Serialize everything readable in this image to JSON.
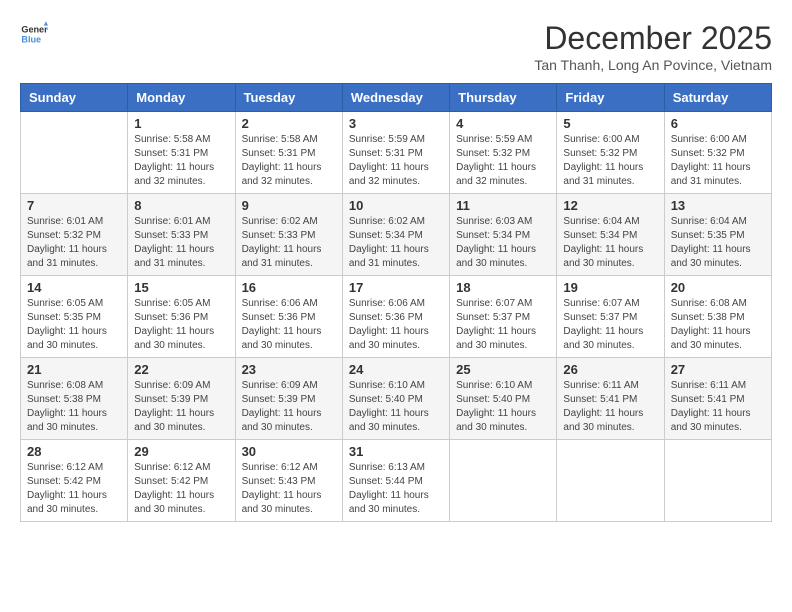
{
  "header": {
    "logo_line1": "General",
    "logo_line2": "Blue",
    "month_year": "December 2025",
    "location": "Tan Thanh, Long An Povince, Vietnam"
  },
  "weekdays": [
    "Sunday",
    "Monday",
    "Tuesday",
    "Wednesday",
    "Thursday",
    "Friday",
    "Saturday"
  ],
  "weeks": [
    [
      {
        "day": "",
        "sunrise": "",
        "sunset": "",
        "daylight": ""
      },
      {
        "day": "1",
        "sunrise": "Sunrise: 5:58 AM",
        "sunset": "Sunset: 5:31 PM",
        "daylight": "Daylight: 11 hours and 32 minutes."
      },
      {
        "day": "2",
        "sunrise": "Sunrise: 5:58 AM",
        "sunset": "Sunset: 5:31 PM",
        "daylight": "Daylight: 11 hours and 32 minutes."
      },
      {
        "day": "3",
        "sunrise": "Sunrise: 5:59 AM",
        "sunset": "Sunset: 5:31 PM",
        "daylight": "Daylight: 11 hours and 32 minutes."
      },
      {
        "day": "4",
        "sunrise": "Sunrise: 5:59 AM",
        "sunset": "Sunset: 5:32 PM",
        "daylight": "Daylight: 11 hours and 32 minutes."
      },
      {
        "day": "5",
        "sunrise": "Sunrise: 6:00 AM",
        "sunset": "Sunset: 5:32 PM",
        "daylight": "Daylight: 11 hours and 31 minutes."
      },
      {
        "day": "6",
        "sunrise": "Sunrise: 6:00 AM",
        "sunset": "Sunset: 5:32 PM",
        "daylight": "Daylight: 11 hours and 31 minutes."
      }
    ],
    [
      {
        "day": "7",
        "sunrise": "Sunrise: 6:01 AM",
        "sunset": "Sunset: 5:32 PM",
        "daylight": "Daylight: 11 hours and 31 minutes."
      },
      {
        "day": "8",
        "sunrise": "Sunrise: 6:01 AM",
        "sunset": "Sunset: 5:33 PM",
        "daylight": "Daylight: 11 hours and 31 minutes."
      },
      {
        "day": "9",
        "sunrise": "Sunrise: 6:02 AM",
        "sunset": "Sunset: 5:33 PM",
        "daylight": "Daylight: 11 hours and 31 minutes."
      },
      {
        "day": "10",
        "sunrise": "Sunrise: 6:02 AM",
        "sunset": "Sunset: 5:34 PM",
        "daylight": "Daylight: 11 hours and 31 minutes."
      },
      {
        "day": "11",
        "sunrise": "Sunrise: 6:03 AM",
        "sunset": "Sunset: 5:34 PM",
        "daylight": "Daylight: 11 hours and 30 minutes."
      },
      {
        "day": "12",
        "sunrise": "Sunrise: 6:04 AM",
        "sunset": "Sunset: 5:34 PM",
        "daylight": "Daylight: 11 hours and 30 minutes."
      },
      {
        "day": "13",
        "sunrise": "Sunrise: 6:04 AM",
        "sunset": "Sunset: 5:35 PM",
        "daylight": "Daylight: 11 hours and 30 minutes."
      }
    ],
    [
      {
        "day": "14",
        "sunrise": "Sunrise: 6:05 AM",
        "sunset": "Sunset: 5:35 PM",
        "daylight": "Daylight: 11 hours and 30 minutes."
      },
      {
        "day": "15",
        "sunrise": "Sunrise: 6:05 AM",
        "sunset": "Sunset: 5:36 PM",
        "daylight": "Daylight: 11 hours and 30 minutes."
      },
      {
        "day": "16",
        "sunrise": "Sunrise: 6:06 AM",
        "sunset": "Sunset: 5:36 PM",
        "daylight": "Daylight: 11 hours and 30 minutes."
      },
      {
        "day": "17",
        "sunrise": "Sunrise: 6:06 AM",
        "sunset": "Sunset: 5:36 PM",
        "daylight": "Daylight: 11 hours and 30 minutes."
      },
      {
        "day": "18",
        "sunrise": "Sunrise: 6:07 AM",
        "sunset": "Sunset: 5:37 PM",
        "daylight": "Daylight: 11 hours and 30 minutes."
      },
      {
        "day": "19",
        "sunrise": "Sunrise: 6:07 AM",
        "sunset": "Sunset: 5:37 PM",
        "daylight": "Daylight: 11 hours and 30 minutes."
      },
      {
        "day": "20",
        "sunrise": "Sunrise: 6:08 AM",
        "sunset": "Sunset: 5:38 PM",
        "daylight": "Daylight: 11 hours and 30 minutes."
      }
    ],
    [
      {
        "day": "21",
        "sunrise": "Sunrise: 6:08 AM",
        "sunset": "Sunset: 5:38 PM",
        "daylight": "Daylight: 11 hours and 30 minutes."
      },
      {
        "day": "22",
        "sunrise": "Sunrise: 6:09 AM",
        "sunset": "Sunset: 5:39 PM",
        "daylight": "Daylight: 11 hours and 30 minutes."
      },
      {
        "day": "23",
        "sunrise": "Sunrise: 6:09 AM",
        "sunset": "Sunset: 5:39 PM",
        "daylight": "Daylight: 11 hours and 30 minutes."
      },
      {
        "day": "24",
        "sunrise": "Sunrise: 6:10 AM",
        "sunset": "Sunset: 5:40 PM",
        "daylight": "Daylight: 11 hours and 30 minutes."
      },
      {
        "day": "25",
        "sunrise": "Sunrise: 6:10 AM",
        "sunset": "Sunset: 5:40 PM",
        "daylight": "Daylight: 11 hours and 30 minutes."
      },
      {
        "day": "26",
        "sunrise": "Sunrise: 6:11 AM",
        "sunset": "Sunset: 5:41 PM",
        "daylight": "Daylight: 11 hours and 30 minutes."
      },
      {
        "day": "27",
        "sunrise": "Sunrise: 6:11 AM",
        "sunset": "Sunset: 5:41 PM",
        "daylight": "Daylight: 11 hours and 30 minutes."
      }
    ],
    [
      {
        "day": "28",
        "sunrise": "Sunrise: 6:12 AM",
        "sunset": "Sunset: 5:42 PM",
        "daylight": "Daylight: 11 hours and 30 minutes."
      },
      {
        "day": "29",
        "sunrise": "Sunrise: 6:12 AM",
        "sunset": "Sunset: 5:42 PM",
        "daylight": "Daylight: 11 hours and 30 minutes."
      },
      {
        "day": "30",
        "sunrise": "Sunrise: 6:12 AM",
        "sunset": "Sunset: 5:43 PM",
        "daylight": "Daylight: 11 hours and 30 minutes."
      },
      {
        "day": "31",
        "sunrise": "Sunrise: 6:13 AM",
        "sunset": "Sunset: 5:44 PM",
        "daylight": "Daylight: 11 hours and 30 minutes."
      },
      {
        "day": "",
        "sunrise": "",
        "sunset": "",
        "daylight": ""
      },
      {
        "day": "",
        "sunrise": "",
        "sunset": "",
        "daylight": ""
      },
      {
        "day": "",
        "sunrise": "",
        "sunset": "",
        "daylight": ""
      }
    ]
  ]
}
